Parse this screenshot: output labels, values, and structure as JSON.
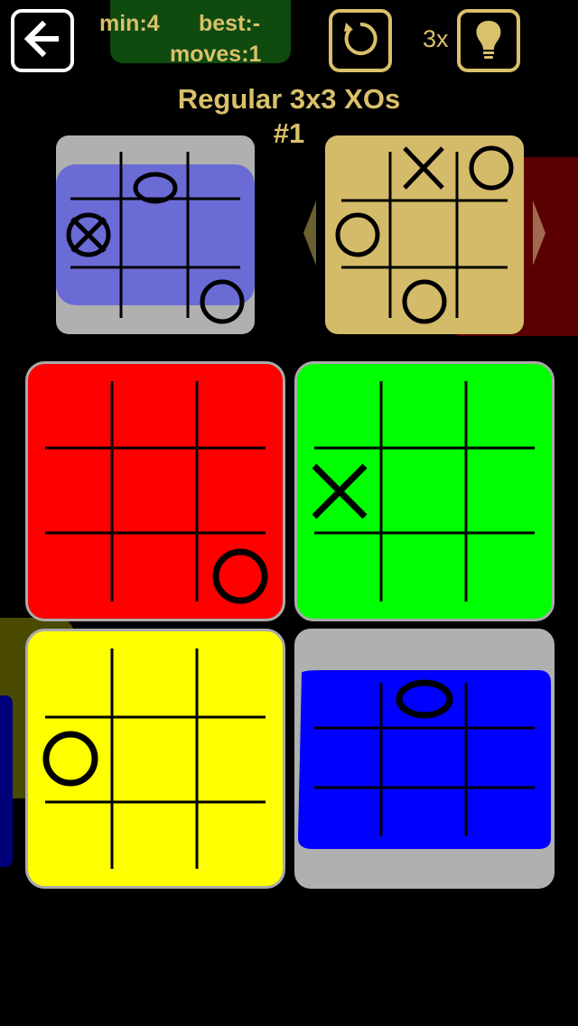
{
  "header": {
    "stats": {
      "min_label": "min:",
      "min_value": "4",
      "best_label": "best:",
      "best_value": "-",
      "moves_label": "moves:",
      "moves_value": "1"
    },
    "hint_count": "3x",
    "icons": {
      "back": "back-arrow-icon",
      "restart": "restart-icon",
      "hint": "lightbulb-icon"
    }
  },
  "title": {
    "line1": "Regular 3x3 XOs",
    "line2": "#1"
  },
  "colors": {
    "gold": "#d9c06a",
    "grey_board": "#b0b0b0",
    "lavender": "#6b6bd6",
    "tan_board": "#d4bb6a",
    "red": "#ff0000",
    "green": "#00ff00",
    "yellow": "#ffff00",
    "blue": "#0000ff",
    "dark_red": "#5a0000"
  },
  "boards": {
    "preview_current": {
      "cells": [
        "",
        "O",
        "",
        "XO",
        "",
        "",
        "",
        "",
        "O"
      ]
    },
    "preview_target": {
      "cells": [
        "",
        "X",
        "O",
        "O",
        "",
        "",
        "",
        "O",
        ""
      ]
    },
    "red": {
      "cells": [
        "",
        "",
        "",
        "",
        "",
        "",
        "",
        "",
        "O"
      ]
    },
    "green": {
      "cells": [
        "",
        "",
        "",
        "X",
        "",
        "",
        "",
        "",
        ""
      ]
    },
    "yellow": {
      "cells": [
        "",
        "",
        "",
        "O",
        "",
        "",
        "",
        "",
        ""
      ]
    },
    "blue": {
      "cells": [
        "",
        "O",
        "",
        "",
        "",
        "",
        "",
        "",
        ""
      ]
    }
  }
}
